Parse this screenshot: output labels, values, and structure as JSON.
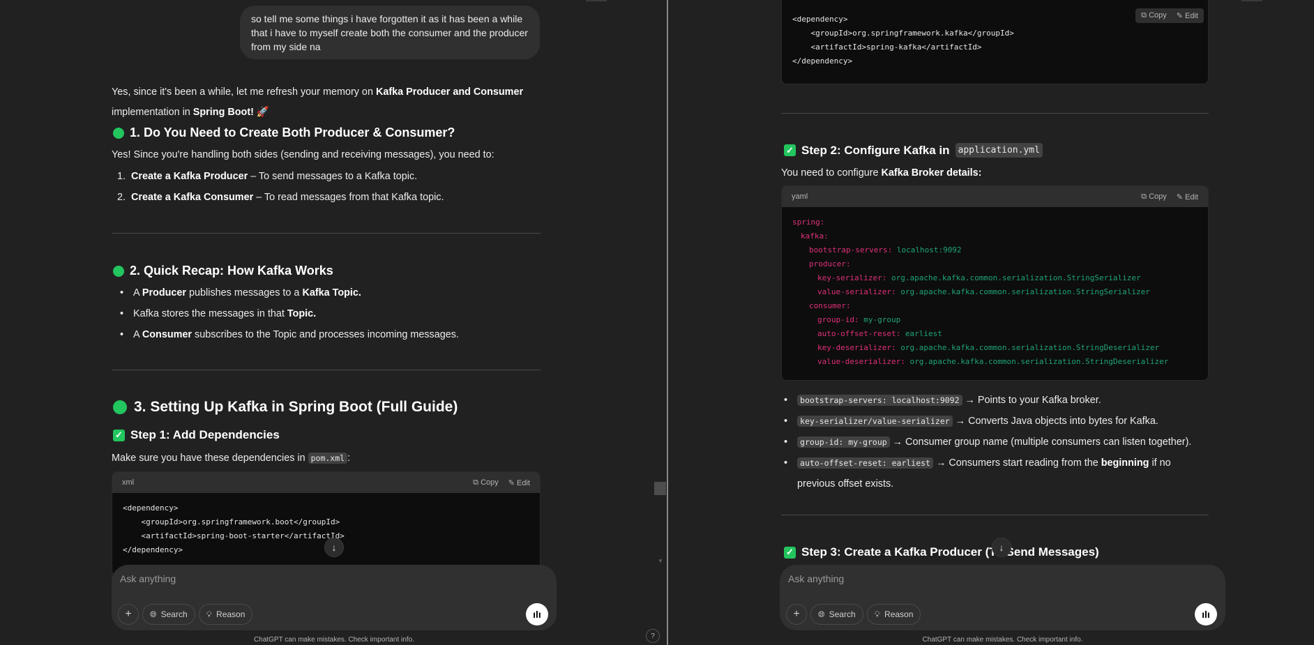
{
  "left": {
    "user_message": "so tell me some things i have forgotten it as it has been a while that i have to myself create both the consumer and the producer from my side na",
    "intro_a": "Yes, since it's been a while, let me refresh your memory on ",
    "intro_b": "Kafka Producer and Consumer",
    "intro_c": "implementation in ",
    "intro_d": "Spring Boot!",
    "intro_emoji": "🚀",
    "h1": "1. Do You Need to Create Both Producer & Consumer?",
    "p1": "Yes! Since you're handling both sides (sending and receiving messages), you need to:",
    "list": [
      {
        "n": "1.",
        "bold": "Create a Kafka Producer",
        "rest": " – To send messages to a Kafka topic."
      },
      {
        "n": "2.",
        "bold": "Create a Kafka Consumer",
        "rest": " – To read messages from that Kafka topic."
      }
    ],
    "h2": "2. Quick Recap: How Kafka Works",
    "recap": [
      {
        "a": "A ",
        "b": "Producer",
        "c": " publishes messages to a ",
        "d": "Kafka Topic."
      },
      {
        "a": "Kafka stores the messages in that ",
        "b": "Topic.",
        "c": "",
        "d": ""
      },
      {
        "a": "A ",
        "b": "Consumer",
        "c": " subscribes to the Topic and processes incoming messages.",
        "d": ""
      }
    ],
    "h3": "3. Setting Up Kafka in Spring Boot (Full Guide)",
    "step1": "Step 1: Add Dependencies",
    "step1_text": "Make sure you have these dependencies in ",
    "step1_code": "pom.xml",
    "step1_colon": ":",
    "code_lang": "xml",
    "code_lines": [
      "<dependency>",
      "    <groupId>org.springframework.boot</groupId>",
      "    <artifactId>spring-boot-starter</artifactId>",
      "</dependency>"
    ]
  },
  "right": {
    "code_lines": [
      "<dependency>",
      "    <groupId>org.springframework.kafka</groupId>",
      "    <artifactId>spring-kafka</artifactId>",
      "</dependency>"
    ],
    "step2": "Step 2: Configure Kafka in ",
    "step2_code": "application.yml",
    "step2_text_a": "You need to configure ",
    "step2_text_b": "Kafka Broker details:",
    "yaml_lang": "yaml",
    "yaml": [
      {
        "k": "spring:",
        "v": "",
        "i": 0
      },
      {
        "k": "kafka:",
        "v": "",
        "i": 1
      },
      {
        "k": "bootstrap-servers:",
        "v": " localhost:9092",
        "i": 2
      },
      {
        "k": "producer:",
        "v": "",
        "i": 2
      },
      {
        "k": "key-serializer:",
        "v": " org.apache.kafka.common.serialization.StringSerializer",
        "i": 3
      },
      {
        "k": "value-serializer:",
        "v": " org.apache.kafka.common.serialization.StringSerializer",
        "i": 3
      },
      {
        "k": "consumer:",
        "v": "",
        "i": 2
      },
      {
        "k": "group-id:",
        "v": " my-group",
        "i": 3
      },
      {
        "k": "auto-offset-reset:",
        "v": " earliest",
        "i": 3
      },
      {
        "k": "key-deserializer:",
        "v": " org.apache.kafka.common.serialization.StringDeserializer",
        "i": 3
      },
      {
        "k": "value-deserializer:",
        "v": " org.apache.kafka.common.serialization.StringDeserializer",
        "i": 3
      }
    ],
    "notes": [
      {
        "code": "bootstrap-servers: localhost:9092",
        "a": " → Points to your Kafka broker.",
        "b": "",
        "c": ""
      },
      {
        "code": "key-serializer/value-serializer",
        "a": " → Converts Java objects into bytes for Kafka.",
        "b": "",
        "c": ""
      },
      {
        "code": "group-id: my-group",
        "a": " → Consumer group name (multiple consumers can listen together).",
        "b": "",
        "c": ""
      },
      {
        "code": "auto-offset-reset: earliest",
        "a": " → Consumers start reading from the ",
        "b": "beginning",
        "c": " if no previous offset exists."
      }
    ],
    "step3": "Step 3: Create a Kafka Producer (To Send Messages)"
  },
  "code_actions": {
    "copy": "Copy",
    "edit": "Edit"
  },
  "composer": {
    "placeholder": "Ask anything",
    "search": "Search",
    "reason": "Reason"
  },
  "footer": "ChatGPT can make mistakes. Check important info.",
  "help": "?",
  "colors": {
    "bg": "#212121",
    "accent": "#22c55e",
    "yaml_key": "#e0307a",
    "yaml_value": "#1fa37a"
  }
}
